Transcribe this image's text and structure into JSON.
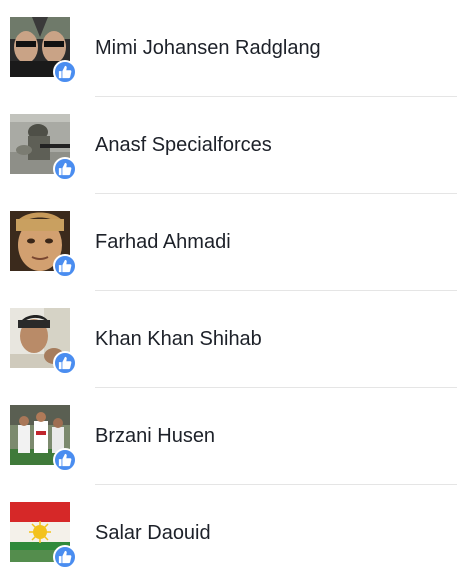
{
  "people": [
    {
      "name": "Mimi Johansen Radglang",
      "avatar": "mirrored-portrait-avatar",
      "badge": "like-icon"
    },
    {
      "name": "Anasf Specialforces",
      "avatar": "soldier-avatar",
      "badge": "like-icon"
    },
    {
      "name": "Farhad Ahmadi",
      "avatar": "face-closeup-avatar",
      "badge": "like-icon"
    },
    {
      "name": "Khan Khan Shihab",
      "avatar": "young-man-avatar",
      "badge": "like-icon"
    },
    {
      "name": "Brzani Husen",
      "avatar": "football-players-avatar",
      "badge": "like-icon"
    },
    {
      "name": "Salar Daouid",
      "avatar": "kurdistan-flag-avatar",
      "badge": "like-icon"
    }
  ],
  "colors": {
    "badge": "#4a8df0",
    "text": "#1d2129",
    "divider": "#e5e5e5"
  }
}
